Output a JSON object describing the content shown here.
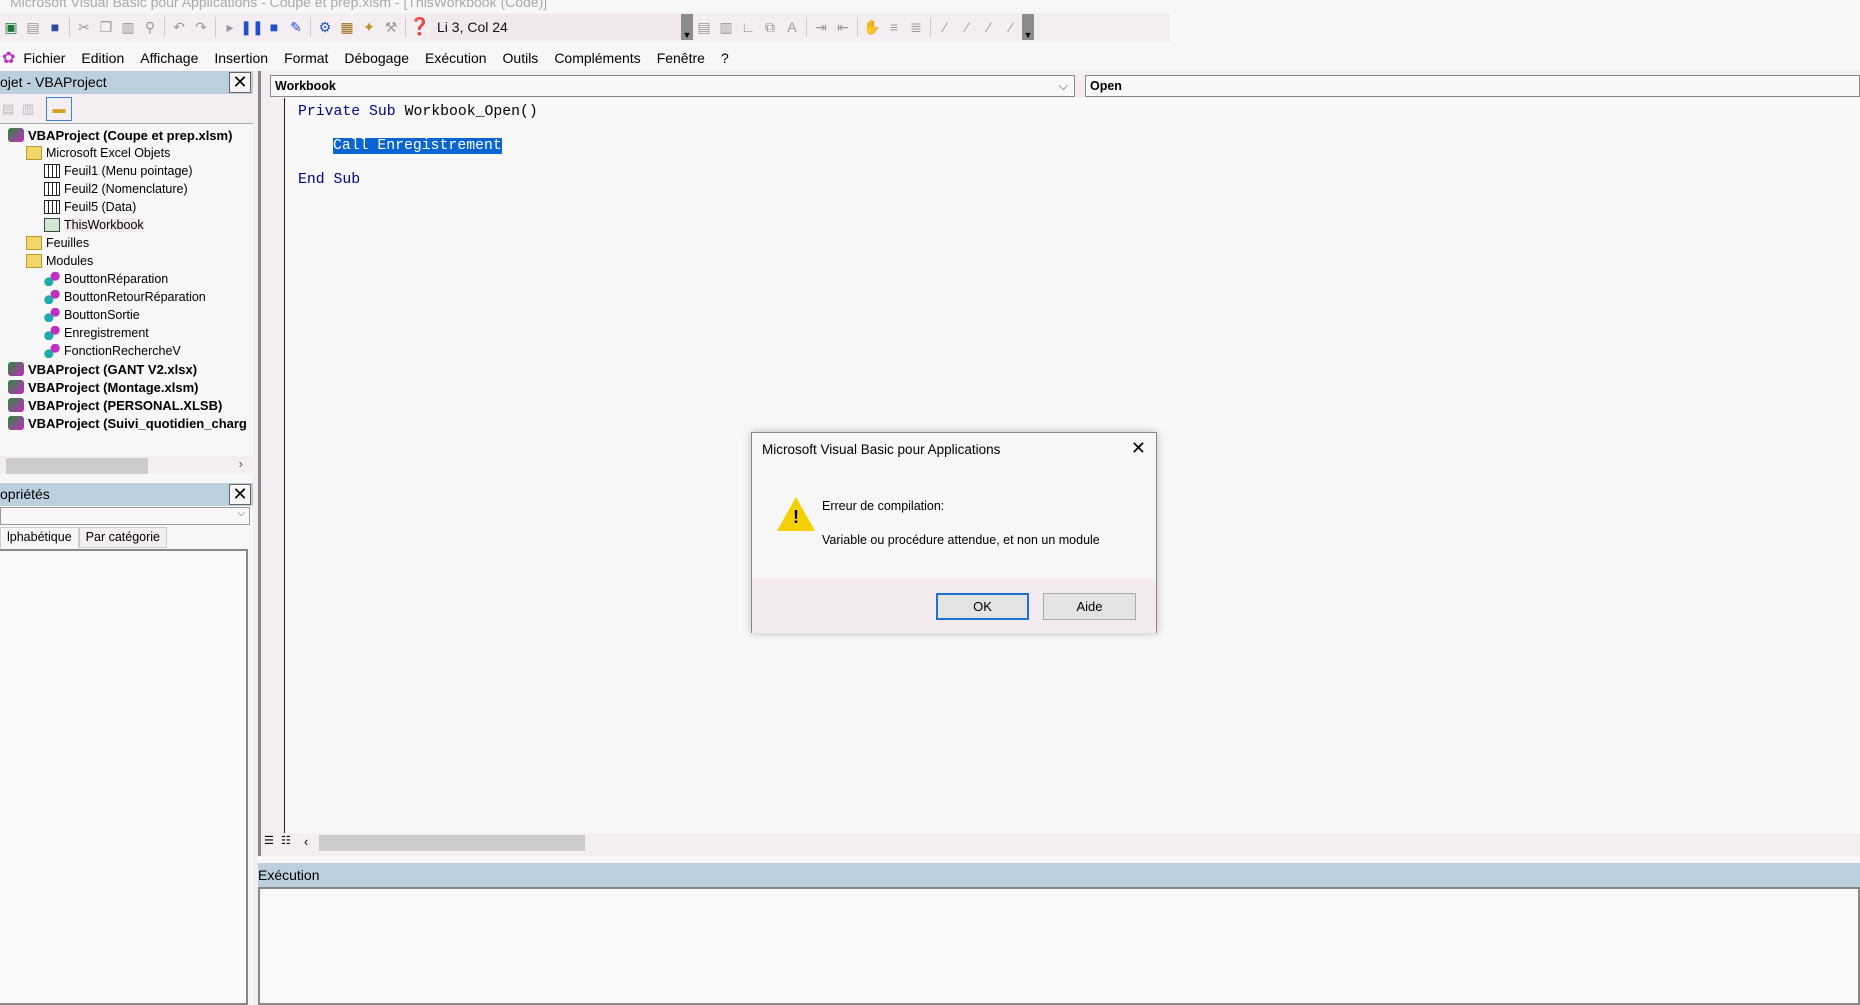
{
  "window": {
    "title": "Microsoft Visual Basic pour Applications - Coupe et prep.xlsm - [ThisWorkbook (Code)]"
  },
  "toolbar": {
    "position": "Li 3, Col 24"
  },
  "menu": [
    "Fichier",
    "Edition",
    "Affichage",
    "Insertion",
    "Format",
    "Débogage",
    "Exécution",
    "Outils",
    "Compléments",
    "Fenêtre",
    "?"
  ],
  "project": {
    "title": "ojet - VBAProject",
    "tree": [
      {
        "label": "VBAProject (Coupe et prep.xlsm)",
        "type": "proj",
        "level": 0
      },
      {
        "label": "Microsoft Excel Objets",
        "type": "fold",
        "level": 1
      },
      {
        "label": "Feuil1 (Menu pointage)",
        "type": "sheet",
        "level": 2
      },
      {
        "label": "Feuil2 (Nomenclature)",
        "type": "sheet",
        "level": 2
      },
      {
        "label": "Feuil5 (Data)",
        "type": "sheet",
        "level": 2
      },
      {
        "label": "ThisWorkbook",
        "type": "wb",
        "level": 2
      },
      {
        "label": "Feuilles",
        "type": "fold",
        "level": 1
      },
      {
        "label": "Modules",
        "type": "fold",
        "level": 1
      },
      {
        "label": "BouttonRéparation",
        "type": "mod",
        "level": 2
      },
      {
        "label": "BouttonRetourRéparation",
        "type": "mod",
        "level": 2
      },
      {
        "label": "BouttonSortie",
        "type": "mod",
        "level": 2
      },
      {
        "label": "Enregistrement",
        "type": "mod",
        "level": 2
      },
      {
        "label": "FonctionRechercheV",
        "type": "mod",
        "level": 2
      },
      {
        "label": "VBAProject (GANT V2.xlsx)",
        "type": "proj",
        "level": 0
      },
      {
        "label": "VBAProject (Montage.xlsm)",
        "type": "proj",
        "level": 0
      },
      {
        "label": "VBAProject (PERSONAL.XLSB)",
        "type": "proj",
        "level": 0
      },
      {
        "label": "VBAProject (Suivi_quotidien_charg",
        "type": "proj",
        "level": 0
      }
    ]
  },
  "properties": {
    "title": "opriétés",
    "tabs": [
      "lphabétique",
      "Par catégorie"
    ]
  },
  "code": {
    "object": "Workbook",
    "procedure": "Open",
    "line1_kw": "Private Sub",
    "line1_rest": " Workbook_Open()",
    "line2": "Call Enregistrement",
    "line3": "End Sub"
  },
  "immediate": {
    "title": "Exécution"
  },
  "dialog": {
    "title": "Microsoft Visual Basic pour Applications",
    "close": "✕",
    "heading": "Erreur de compilation:",
    "message": "Variable ou procédure attendue, et non un module",
    "ok": "OK",
    "help": "Aide"
  }
}
